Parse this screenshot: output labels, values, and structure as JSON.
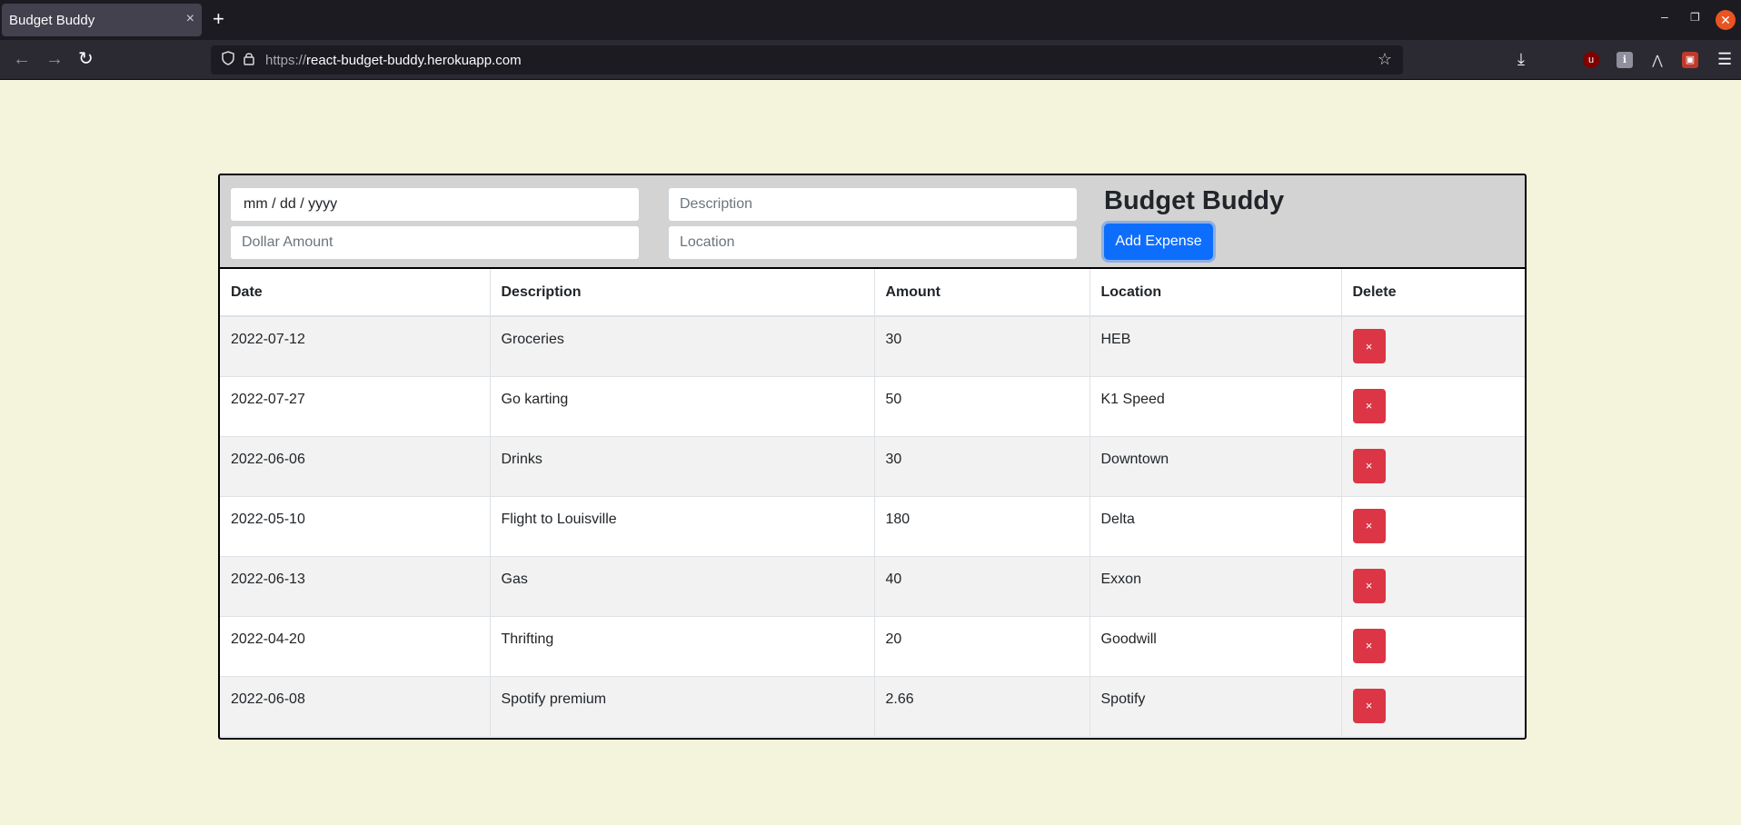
{
  "browser": {
    "tab_title": "Budget Buddy",
    "tab_close_glyph": "×",
    "new_tab_glyph": "+",
    "url_scheme": "https://",
    "url_host": "react-budget-buddy.herokuapp.com"
  },
  "form": {
    "date_placeholder": "mm / dd / yyyy",
    "description_placeholder": "Description",
    "amount_placeholder": "Dollar Amount",
    "location_placeholder": "Location",
    "app_title": "Budget Buddy",
    "add_button_label": "Add Expense"
  },
  "table": {
    "headers": [
      "Date",
      "Description",
      "Amount",
      "Location",
      "Delete"
    ],
    "delete_glyph": "×",
    "rows": [
      {
        "date": "2022-07-12",
        "description": "Groceries",
        "amount": "30",
        "location": "HEB"
      },
      {
        "date": "2022-07-27",
        "description": "Go karting",
        "amount": "50",
        "location": "K1 Speed"
      },
      {
        "date": "2022-06-06",
        "description": "Drinks",
        "amount": "30",
        "location": "Downtown"
      },
      {
        "date": "2022-05-10",
        "description": "Flight to Louisville",
        "amount": "180",
        "location": "Delta"
      },
      {
        "date": "2022-06-13",
        "description": "Gas",
        "amount": "40",
        "location": "Exxon"
      },
      {
        "date": "2022-04-20",
        "description": "Thrifting",
        "amount": "20",
        "location": "Goodwill"
      },
      {
        "date": "2022-06-08",
        "description": "Spotify premium",
        "amount": "2.66",
        "location": "Spotify"
      }
    ]
  },
  "colors": {
    "page_background": "#f4f4dc",
    "form_background": "#d3d3d3",
    "primary_button": "#0d6efd",
    "danger_button": "#dc3545"
  }
}
